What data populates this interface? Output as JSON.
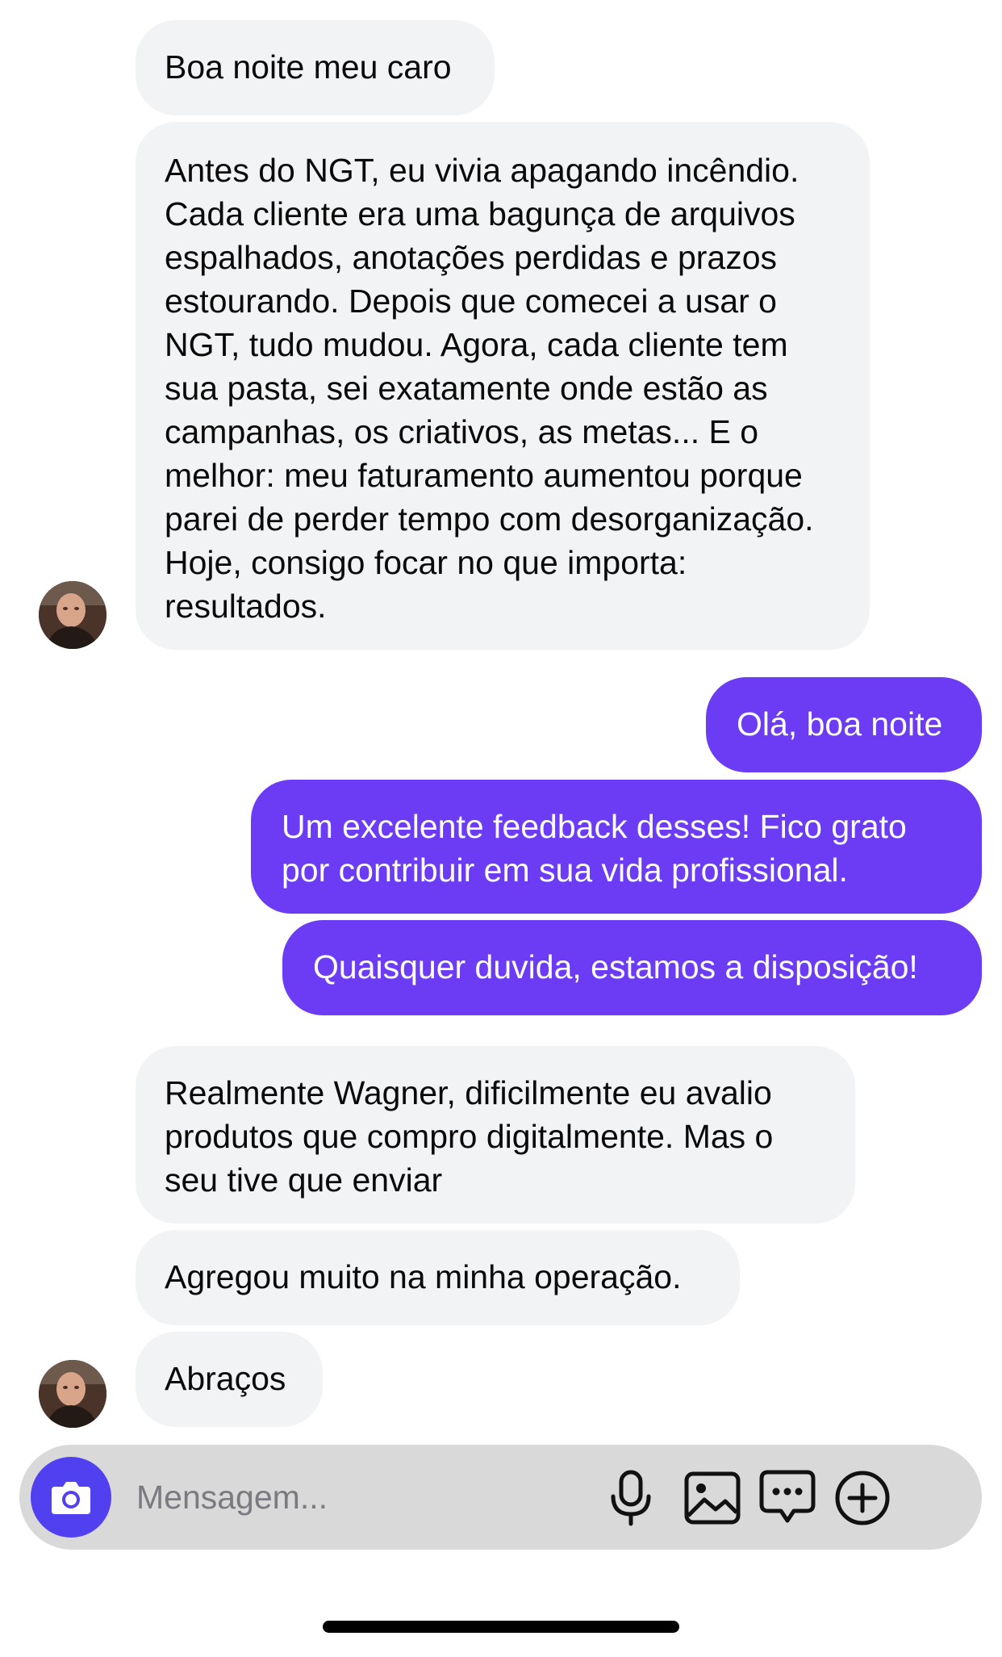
{
  "messages": {
    "m1": "Boa noite meu caro",
    "m2": "Antes do NGT, eu vivia apagando incêndio. Cada cliente era uma bagunça de arquivos espalhados, anotações perdidas e prazos estourando. Depois que comecei a usar o NGT, tudo mudou. Agora, cada cliente tem sua pasta, sei exatamente onde estão as campanhas, os criativos, as metas... E o melhor: meu faturamento aumentou porque parei de perder tempo com desorganização. Hoje, consigo focar no que importa: resultados.",
    "m3": "Olá, boa noite",
    "m4": "Um excelente feedback desses! Fico grato por contribuir em sua vida profissional.",
    "m5": "Quaisquer duvida, estamos a disposição!",
    "m6": "Realmente Wagner, dificilmente eu avalio produtos que compro digitalmente. Mas o seu tive que enviar",
    "m7": "Agregou muito na minha operação.",
    "m8": "Abraços"
  },
  "composer": {
    "placeholder": "Mensagem...",
    "icons": [
      "camera-icon",
      "microphone-icon",
      "image-icon",
      "sticker-chat-icon",
      "plus-icon"
    ]
  },
  "colors": {
    "incoming_bubble": "#f2f3f5",
    "outgoing_bubble": "#6c3cf5",
    "camera_button": "#5140f0",
    "composer_bg": "#d9d9d9"
  }
}
